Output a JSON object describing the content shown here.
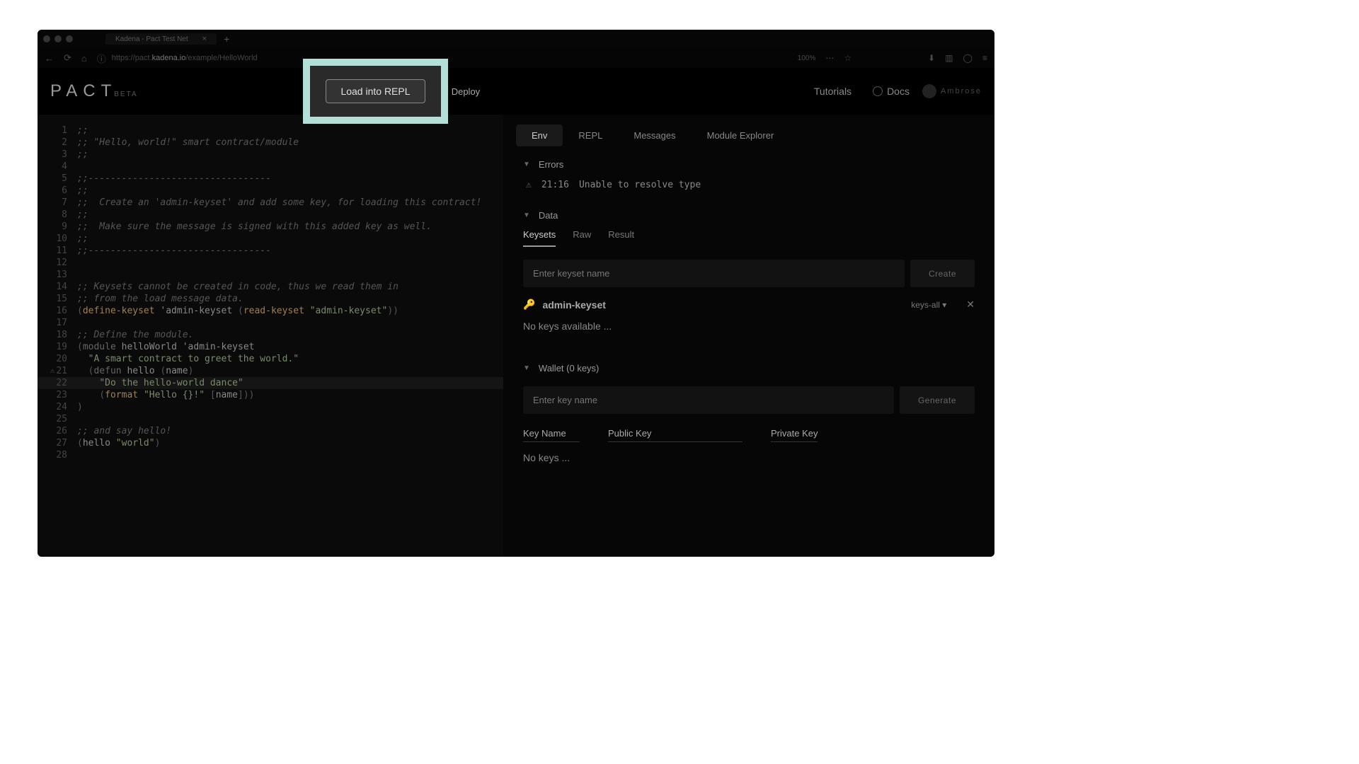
{
  "browser": {
    "tab_title": "Kadena - Pact Test Net",
    "url_prefix": "https://pact.",
    "url_host": "kadena.io",
    "url_path": "/example/HelloWorld",
    "zoom": "100%"
  },
  "header": {
    "logo": "PACT",
    "logo_sub": "BETA",
    "load_repl": "Load into REPL",
    "deploy": "Deploy",
    "tutorials": "Tutorials",
    "docs": "Docs",
    "user": "Ambrose"
  },
  "editor": {
    "lines": [
      {
        "n": 1,
        "cls": "",
        "html": "<span class='cm'>;;</span>"
      },
      {
        "n": 2,
        "cls": "",
        "html": "<span class='cm'>;; \"Hello, world!\" smart contract/module</span>"
      },
      {
        "n": 3,
        "cls": "",
        "html": "<span class='cm'>;;</span>"
      },
      {
        "n": 4,
        "cls": "",
        "html": ""
      },
      {
        "n": 5,
        "cls": "",
        "html": "<span class='cm'>;;---------------------------------</span>"
      },
      {
        "n": 6,
        "cls": "",
        "html": "<span class='cm'>;;</span>"
      },
      {
        "n": 7,
        "cls": "",
        "html": "<span class='cm'>;;  Create an 'admin-keyset' and add some key, for loading this contract!</span>"
      },
      {
        "n": 8,
        "cls": "",
        "html": "<span class='cm'>;;</span>"
      },
      {
        "n": 9,
        "cls": "",
        "html": "<span class='cm'>;;  Make sure the message is signed with this added key as well.</span>"
      },
      {
        "n": 10,
        "cls": "",
        "html": "<span class='cm'>;;</span>"
      },
      {
        "n": 11,
        "cls": "",
        "html": "<span class='cm'>;;---------------------------------</span>"
      },
      {
        "n": 12,
        "cls": "",
        "html": ""
      },
      {
        "n": 13,
        "cls": "",
        "html": ""
      },
      {
        "n": 14,
        "cls": "",
        "html": "<span class='cm'>;; Keysets cannot be created in code, thus we read them in</span>"
      },
      {
        "n": 15,
        "cls": "",
        "html": "<span class='cm'>;; from the load message data.</span>"
      },
      {
        "n": 16,
        "cls": "",
        "html": "<span class='pn'>(</span><span class='fn'>define-keyset</span> <span class='id'>'admin-keyset</span> <span class='pn'>(</span><span class='fn'>read-keyset</span> <span class='st'>\"admin-keyset\"</span><span class='pn'>))</span>"
      },
      {
        "n": 17,
        "cls": "",
        "html": ""
      },
      {
        "n": 18,
        "cls": "",
        "html": "<span class='cm'>;; Define the module.</span>"
      },
      {
        "n": 19,
        "cls": "",
        "html": "<span class='pn'>(</span><span class='kw'>module</span> <span class='id'>helloWorld</span> <span class='id'>'admin-keyset</span>"
      },
      {
        "n": 20,
        "cls": "",
        "html": "  <span class='st'>\"A smart contract to greet the world.\"</span>"
      },
      {
        "n": 21,
        "cls": "warn",
        "html": "  <span class='pn'>(</span><span class='kw'>defun</span> <span class='id'>hello</span> <span class='pn'>(</span><span class='id'>name</span><span class='pn'>)</span>"
      },
      {
        "n": 22,
        "cls": "hl-line",
        "html": "    <span class='st'>\"Do the hello-world dance\"</span>"
      },
      {
        "n": 23,
        "cls": "",
        "html": "    <span class='pn'>(</span><span class='fn'>format</span> <span class='st'>\"Hello {}!\"</span> <span class='pn'>[</span><span class='id'>name</span><span class='pn'>]))</span>"
      },
      {
        "n": 24,
        "cls": "",
        "html": "<span class='pn'>)</span>"
      },
      {
        "n": 25,
        "cls": "",
        "html": ""
      },
      {
        "n": 26,
        "cls": "",
        "html": "<span class='cm'>;; and say hello!</span>"
      },
      {
        "n": 27,
        "cls": "",
        "html": "<span class='pn'>(</span><span class='id'>hello</span> <span class='st'>\"world\"</span><span class='pn'>)</span>"
      },
      {
        "n": 28,
        "cls": "",
        "html": ""
      }
    ]
  },
  "right": {
    "tabs": [
      "Env",
      "REPL",
      "Messages",
      "Module Explorer"
    ],
    "active_tab": "Env",
    "errors_label": "Errors",
    "error": {
      "loc": "21:16",
      "msg": "Unable to resolve type"
    },
    "data_label": "Data",
    "subtabs": [
      "Keysets",
      "Raw",
      "Result"
    ],
    "active_subtab": "Keysets",
    "keyset_placeholder": "Enter keyset name",
    "create_btn": "Create",
    "keyset_name": "admin-keyset",
    "keyset_pred": "keys-all",
    "no_keys_msg": "No keys available ...",
    "wallet_label": "Wallet (0 keys)",
    "keyname_placeholder": "Enter key name",
    "generate_btn": "Generate",
    "cols": {
      "name": "Key Name",
      "pub": "Public Key",
      "priv": "Private Key"
    },
    "no_keys2": "No keys ..."
  },
  "highlight": {
    "label": "Load into REPL"
  }
}
